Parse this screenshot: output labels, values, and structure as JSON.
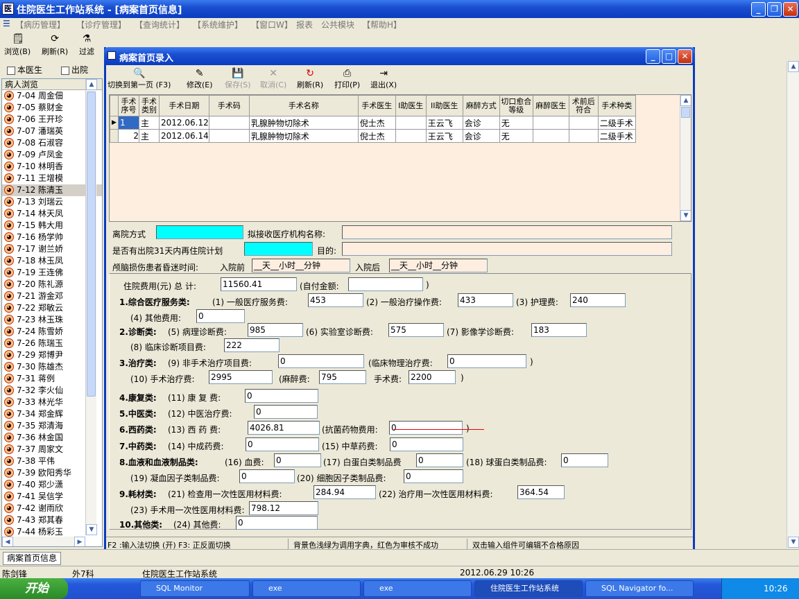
{
  "app": {
    "title": "住院医生工作站系统 - [病案首页信息]",
    "menu": [
      "【病历管理】",
      "【诊疗管理】",
      "【查询统计】",
      "【系统维护】",
      "【窗口W】",
      "报表",
      "公共模块",
      "【帮助H】"
    ],
    "toolbar": {
      "browse": "浏览(B)",
      "refresh": "刷新(R)",
      "filter": "过滤"
    }
  },
  "left": {
    "my_doctor": "本医生",
    "discharged": "出院",
    "header": "病人浏览",
    "patients": [
      "7-04  周金佃",
      "7-05  蔡财金",
      "7-06  王开珍",
      "7-07  潘瑞英",
      "7-08  石淑容",
      "7-09  卢凤金",
      "7-10  林明香",
      "7-11  王增模",
      "7-12  陈清玉",
      "7-13  刘瑞云",
      "7-14  林天凤",
      "7-15  韩大用",
      "7-16  杨学帅",
      "7-17  谢兰娇",
      "7-18  林玉凤",
      "7-19  王连佛",
      "7-20  陈礼源",
      "7-21  游金邓",
      "7-22  郑敏云",
      "7-23  林玉珠",
      "7-24  陈雪娇",
      "7-26  陈瑞玉",
      "7-29  郑博尹",
      "7-30  陈雄杰",
      "7-31  蒋例",
      "7-32  李火仙",
      "7-33  林光华",
      "7-34  郑金辉",
      "7-35  郑清海",
      "7-36  林金国",
      "7-37  周家文",
      "7-38  平伟",
      "7-39  欧阳秀华",
      "7-40  郑少潇",
      "7-41  吴信学",
      "7-42  谢雨欣",
      "7-43  郑其春",
      "7-44  杨彩玉"
    ]
  },
  "dialog": {
    "title": "病案首页录入",
    "toolbar": {
      "first_page": "切换到第一页 (F3)",
      "edit": "修改(E)",
      "save": "保存(S)",
      "cancel": "取消(C)",
      "refresh": "刷新(R)",
      "print": "打印(P)",
      "exit": "退出(X)"
    },
    "grid": {
      "columns": [
        "手术序号",
        "手术类别",
        "手术日期",
        "手术码",
        "手术名称",
        "手术医生",
        "I助医生",
        "II助医生",
        "麻醉方式",
        "切口愈合等级",
        "麻醉医生",
        "术前后符合",
        "手术种类"
      ],
      "rows": [
        [
          "1",
          "主",
          "2012.06.12",
          "",
          "乳腺肿物切除术",
          "倪士杰",
          "",
          "王云飞",
          "会诊",
          "无",
          "",
          "",
          "二级手术"
        ],
        [
          "2",
          "主",
          "2012.06.14",
          "",
          "乳腺肿物切除术",
          "倪士杰",
          "",
          "王云飞",
          "会诊",
          "无",
          "",
          "",
          "二级手术"
        ]
      ]
    },
    "discharge_method": "离院方式",
    "transfer_org": "拟接收医疗机构名称:",
    "readmit_plan": "是否有出院31天内再住院计划",
    "purpose": "目的:",
    "coma_label": "颅脑损伤患者昏迷时间:",
    "before_admit": "入院前",
    "after_admit": "入院后",
    "coma_before": "__天__小时__分钟",
    "coma_after": "__天__小时__分钟",
    "fees": {
      "total_label": "住院费用(元) 总  计:",
      "total": "11560.41",
      "self_pay_label": "(自付金额:",
      "self_pay": "",
      "close_paren": ")",
      "c1": "1.综合医疗服务类:",
      "c1_1": "(1) 一般医疗服务费:",
      "v1_1": "453",
      "c1_2": "(2) 一般治疗操作费:",
      "v1_2": "433",
      "c1_3": "(3) 护理费:",
      "v1_3": "240",
      "c1_4": "(4) 其他费用:",
      "v1_4": "0",
      "c2": "2.诊断类:",
      "c2_5": "(5) 病理诊断费:",
      "v2_5": "985",
      "c2_6": "(6) 实验室诊断费:",
      "v2_6": "575",
      "c2_7": "(7) 影像学诊断费:",
      "v2_7": "183",
      "c2_8": "(8) 临床诊断项目费:",
      "v2_8": "222",
      "c3": "3.治疗类:",
      "c3_9": "(9) 非手术治疗项目费:",
      "v3_9": "0",
      "c3_phys": "(临床物理治疗费:",
      "v3_phys": "0",
      "c3_10": "(10) 手术治疗费:",
      "v3_10": "2995",
      "c3_anes": "(麻醉费:",
      "v3_anes": "795",
      "c3_surg": "手术费:",
      "v3_surg": "2200",
      "c4": "4.康复类:",
      "c4_11": "(11) 康 复 费:",
      "v4_11": "0",
      "c5": "5.中医类:",
      "c5_12": "(12) 中医治疗费:",
      "v5_12": "0",
      "c6": "6.西药类:",
      "c6_13": "(13) 西 药 费:",
      "v6_13": "4026.81",
      "c6_anti": "(抗菌药物费用:",
      "v6_anti": "0",
      "c7": "7.中药类:",
      "c7_14": "(14) 中成药费:",
      "v7_14": "0",
      "c7_15": "(15) 中草药费:",
      "v7_15": "0",
      "c8": "8.血液和血液制品类:",
      "c8_16": "(16) 血费:",
      "v8_16": "0",
      "c8_17": "(17) 白蛋白类制品费",
      "v8_17": "0",
      "c8_18": "(18) 球蛋白类制品费:",
      "v8_18": "0",
      "c8_19": "(19) 凝血因子类制品费:",
      "v8_19": "0",
      "c8_20": "(20) 细胞因子类制品费:",
      "v8_20": "0",
      "c9": "9.耗材类:",
      "c9_21": "(21) 检查用一次性医用材料费:",
      "v9_21": "284.94",
      "c9_22": "(22) 治疗用一次性医用材料费:",
      "v9_22": "364.54",
      "c9_23": "(23) 手术用一次性医用材料费:",
      "v9_23": "798.12",
      "c10": "10.其他类:",
      "c10_24": "(24) 其他费:",
      "v10_24": "0"
    },
    "status": {
      "s1": "F2 :输入法切换 (开) F3:  正反面切换",
      "s2": "背景色浅绿为调用字典，红色为审核不成功",
      "s3": "双击输入组件可编辑不合格原因"
    }
  },
  "bottom": {
    "tab": "病案首页信息",
    "user": "陈剑锋",
    "dept": "外7科",
    "system": "住院医生工作站系统",
    "datetime": "2012.06.29 10:26"
  },
  "taskbar": {
    "start": "开始",
    "tasks": [
      "SQL Monitor",
      "exe",
      "exe",
      "住院医生工作站系统",
      "SQL Navigator fo..."
    ],
    "time": "10:26"
  }
}
